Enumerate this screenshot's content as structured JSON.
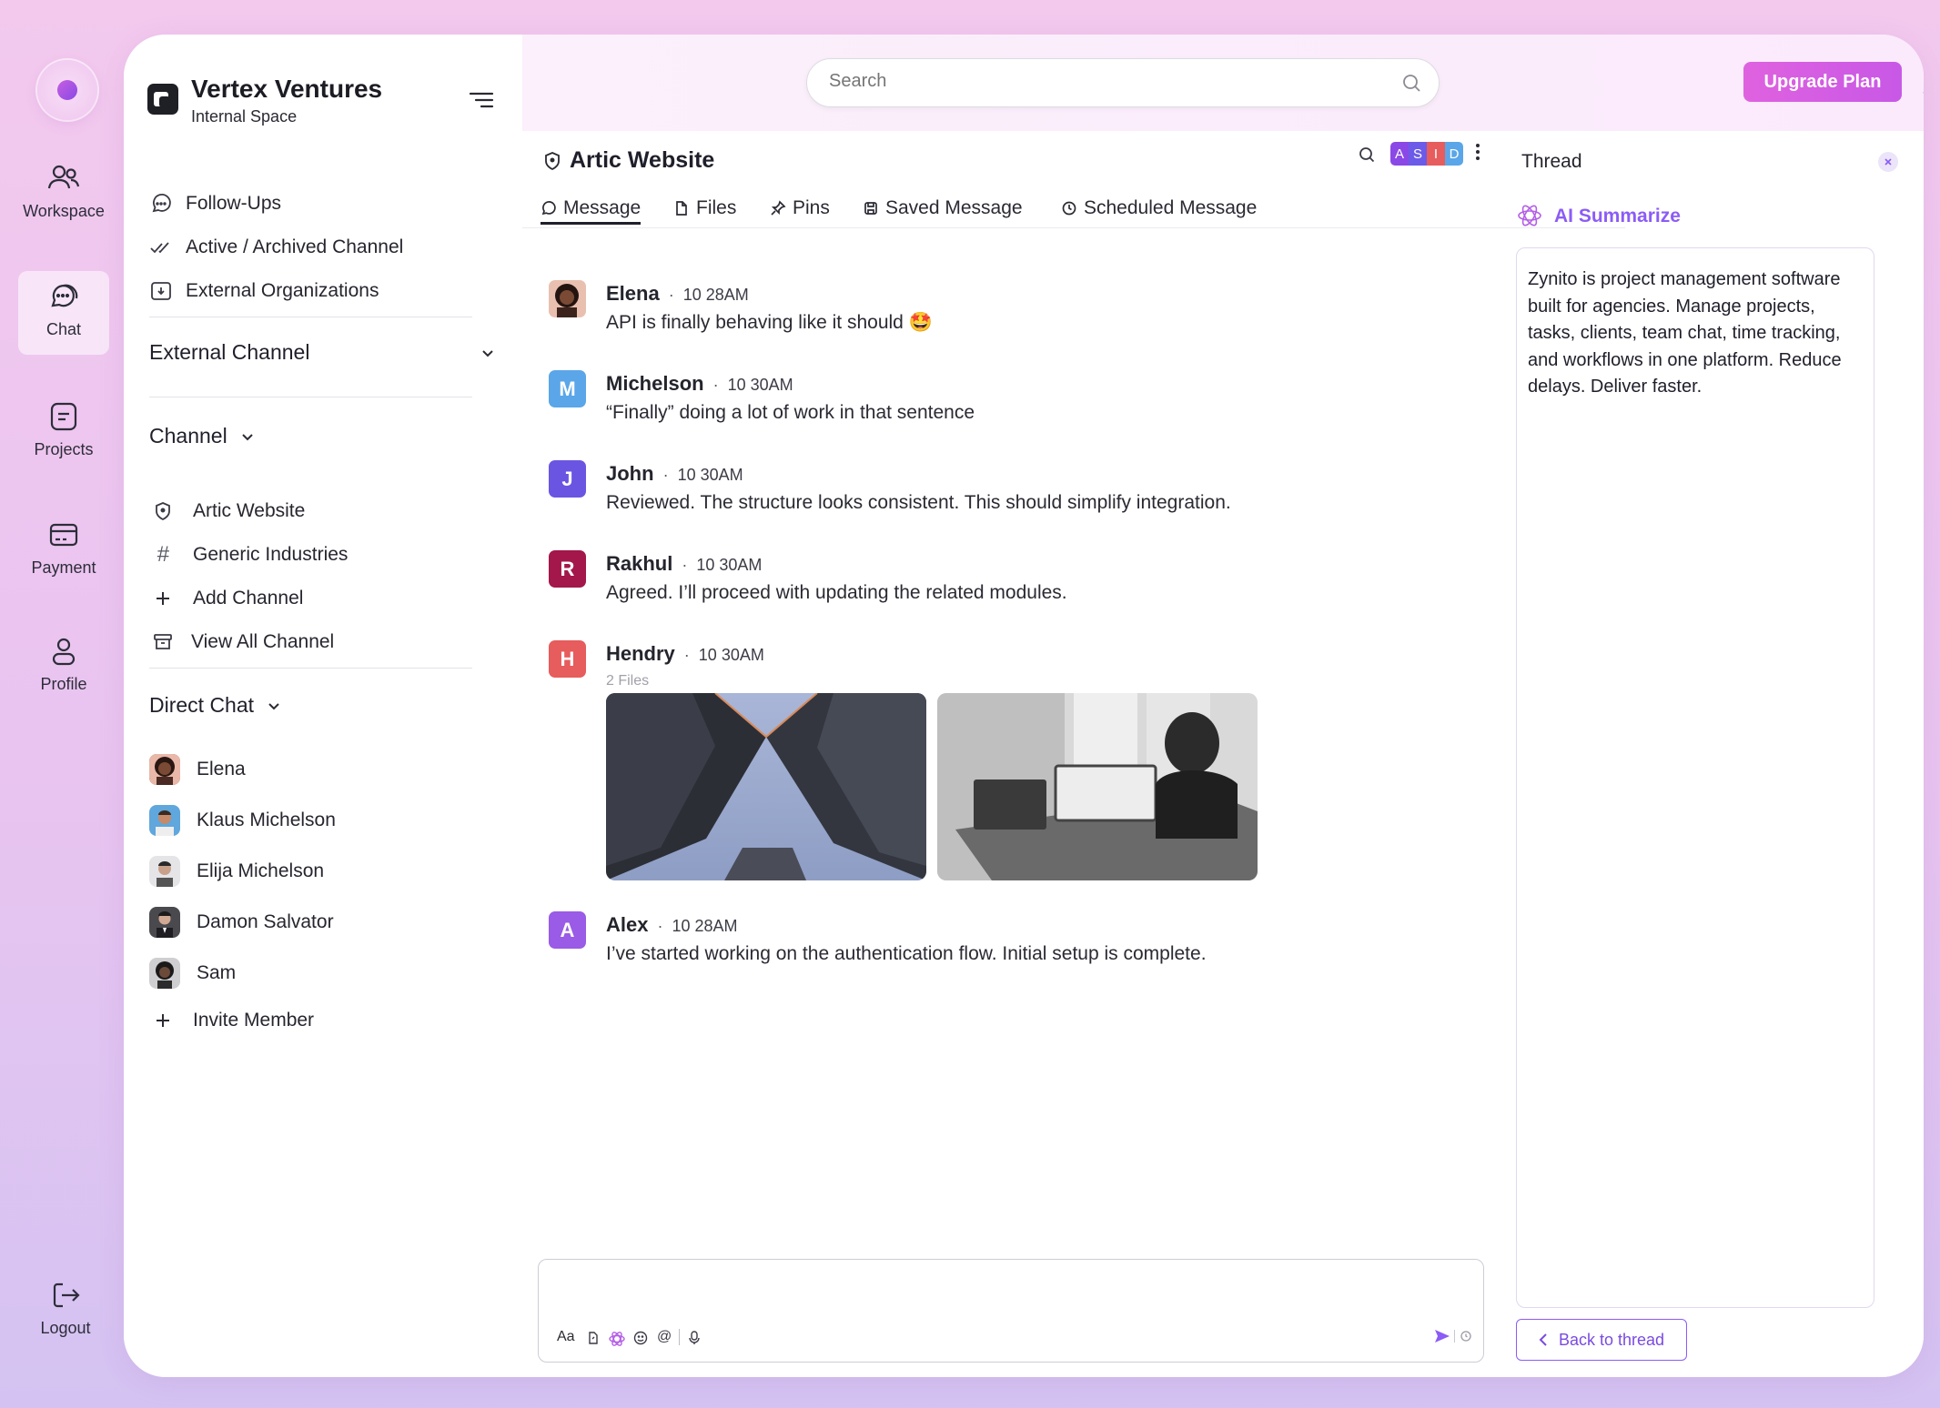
{
  "rail": {
    "items": [
      {
        "label": "Workspace",
        "icon": "users-icon"
      },
      {
        "label": "Chat",
        "icon": "chat-icon"
      },
      {
        "label": "Projects",
        "icon": "projects-icon"
      },
      {
        "label": "Payment",
        "icon": "card-icon"
      },
      {
        "label": "Profile",
        "icon": "profile-icon"
      }
    ],
    "logout": "Logout"
  },
  "org": {
    "name": "Vertex Ventures",
    "subtitle": "Internal Space"
  },
  "sidebar": {
    "top_items": [
      "Follow-Ups",
      "Active / Archived Channel",
      "External Organizations"
    ],
    "external_channel": "External Channel",
    "channel_header": "Channel",
    "channels": [
      "Artic Website",
      "Generic Industries",
      "Add Channel",
      "View All Channel"
    ],
    "direct_header": "Direct Chat",
    "direct": [
      "Elena",
      "Klaus Michelson",
      "Elija Michelson",
      "Damon Salvator",
      "Sam"
    ],
    "invite": "Invite Member"
  },
  "topbar": {
    "search_placeholder": "Search",
    "upgrade": "Upgrade Plan"
  },
  "channel": {
    "title": "Artic Website",
    "member_initials": [
      "A",
      "S",
      "I",
      "D"
    ],
    "tabs": [
      "Message",
      "Files",
      "Pins",
      "Saved Message",
      "Scheduled Message"
    ]
  },
  "messages": [
    {
      "name": "Elena",
      "time": "10 28AM",
      "text": "API is finally behaving like it should 🤩"
    },
    {
      "name": "Michelson",
      "initial": "M",
      "time": "10 30AM",
      "text": "“Finally” doing a lot of work in that sentence"
    },
    {
      "name": "John",
      "initial": "J",
      "time": "10 30AM",
      "text": "Reviewed. The structure looks consistent. This should simplify integration."
    },
    {
      "name": "Rakhul",
      "initial": "R",
      "time": "10 30AM",
      "text": "Agreed. I’ll proceed with updating the related modules."
    },
    {
      "name": "Hendry",
      "initial": "H",
      "time": "10 30AM",
      "text": "2 Files"
    },
    {
      "name": "Alex",
      "initial": "A",
      "time": "10 28AM",
      "text": "I’ve started working on the authentication flow. Initial setup is complete."
    }
  ],
  "composer": {
    "format_label": "Aa"
  },
  "thread": {
    "title": "Thread",
    "ai_label": "AI Summarize",
    "summary": "Zynito is project management software built for agencies. Manage projects, tasks, clients, team chat, time tracking, and workflows in one platform. Reduce delays. Deliver faster.",
    "back": "Back to thread"
  },
  "colors": {
    "accent": "#8b5cf6",
    "upgrade_bg": "#d85fe0",
    "michelson": "#5aa6e8",
    "john": "#6a55e2",
    "rakhul": "#a3174a",
    "hendry": "#e75c5c",
    "alex": "#9a5be6"
  }
}
